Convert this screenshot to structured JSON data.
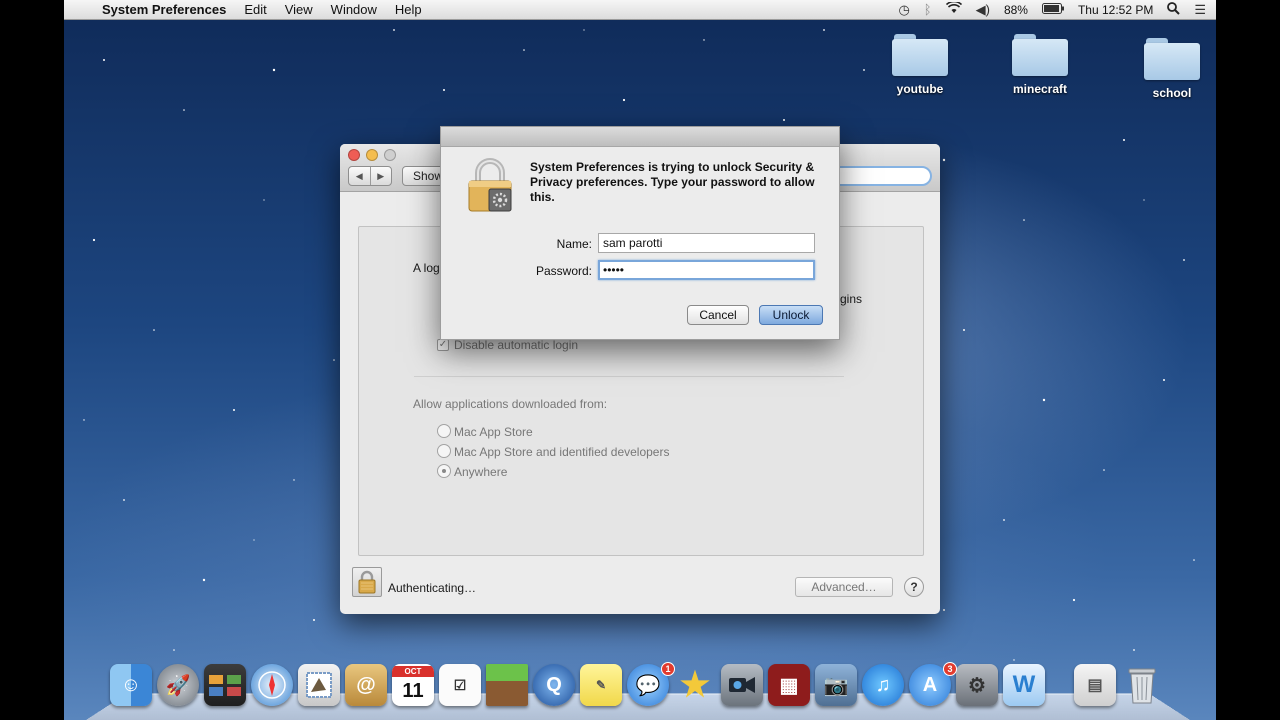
{
  "menubar": {
    "app_name": "System Preferences",
    "items": [
      "Edit",
      "View",
      "Window",
      "Help"
    ],
    "battery": "88%",
    "clock": "Thu 12:52 PM"
  },
  "desktop": {
    "folders": [
      "youtube",
      "minecraft",
      "school"
    ]
  },
  "sys_prefs": {
    "show_all_label": "Show",
    "login_heading": "A log",
    "logins_fragment": "gins",
    "disable_auto_login": "Disable automatic login",
    "allow_apps_heading": "Allow applications downloaded from:",
    "options": [
      "Mac App Store",
      "Mac App Store and identified developers",
      "Anywhere"
    ],
    "selected_option": "Anywhere",
    "status_text": "Authenticating…",
    "advanced_label": "Advanced…",
    "help_label": "?"
  },
  "auth_dialog": {
    "message": "System Preferences is trying to unlock Security & Privacy preferences. Type your password to allow this.",
    "name_label": "Name:",
    "name_value": "sam parotti",
    "password_label": "Password:",
    "password_value": "•••••",
    "cancel_label": "Cancel",
    "unlock_label": "Unlock"
  },
  "dock": {
    "calendar_day": "11",
    "calendar_month": "OCT",
    "badges": {
      "messages": "1",
      "app_store": "3"
    }
  }
}
